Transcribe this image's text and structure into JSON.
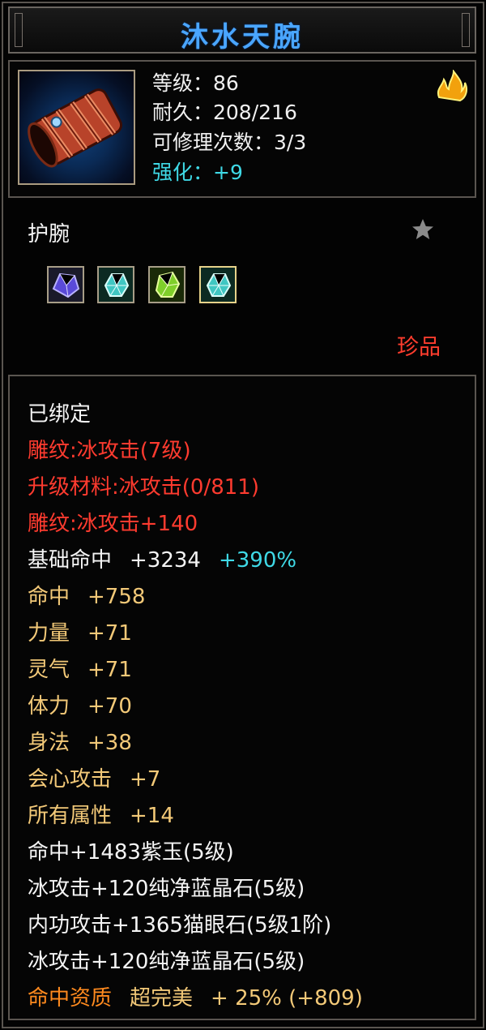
{
  "title": "沐水天腕",
  "stats": {
    "level": "等级：86",
    "durability": "耐久：208/216",
    "repairs": "可修理次数：3/3",
    "enhance": "强化：+9"
  },
  "type_label": "护腕",
  "rarity": "珍品",
  "icons": {
    "item": "bracer-icon",
    "flame": "flame-icon",
    "star": "star-icon",
    "gems": [
      "purple-gem-icon",
      "cyan-gem-icon",
      "green-gem-icon",
      "cyan-gem-icon"
    ]
  },
  "colors": {
    "title": "#4aa6ff",
    "engrave": "#ff3b2f",
    "attribute": "#f3c978",
    "bonus": "#3fd9e6",
    "rarity": "#ff3d2e",
    "aptitude": "#ff8a1e"
  },
  "attributes": {
    "bound": "已绑定",
    "engrave1": "雕纹:冰攻击(7级)",
    "upgrade": "升级材料:冰攻击(0/811)",
    "engrave2": "雕纹:冰攻击+140",
    "base_hit_label": "基础命中",
    "base_hit_value": "+3234",
    "base_hit_bonus": "+390%",
    "hit": "命中",
    "hit_value": "+758",
    "strength": "力量",
    "strength_value": "+71",
    "spirit": "灵气",
    "spirit_value": "+71",
    "stamina": "体力",
    "stamina_value": "+70",
    "agility": "身法",
    "agility_value": "+38",
    "crit": "会心攻击",
    "crit_value": "+7",
    "all_attr": "所有属性",
    "all_attr_value": "+14",
    "gem1": "命中+1483紫玉(5级)",
    "gem2": "冰攻击+120纯净蓝晶石(5级)",
    "gem3": "内功攻击+1365猫眼石(5级1阶)",
    "gem4": "冰攻击+120纯净蓝晶石(5级)",
    "aptitude_label": "命中资质",
    "aptitude_grade": "超完美",
    "aptitude_value": "+ 25% (+809)"
  }
}
